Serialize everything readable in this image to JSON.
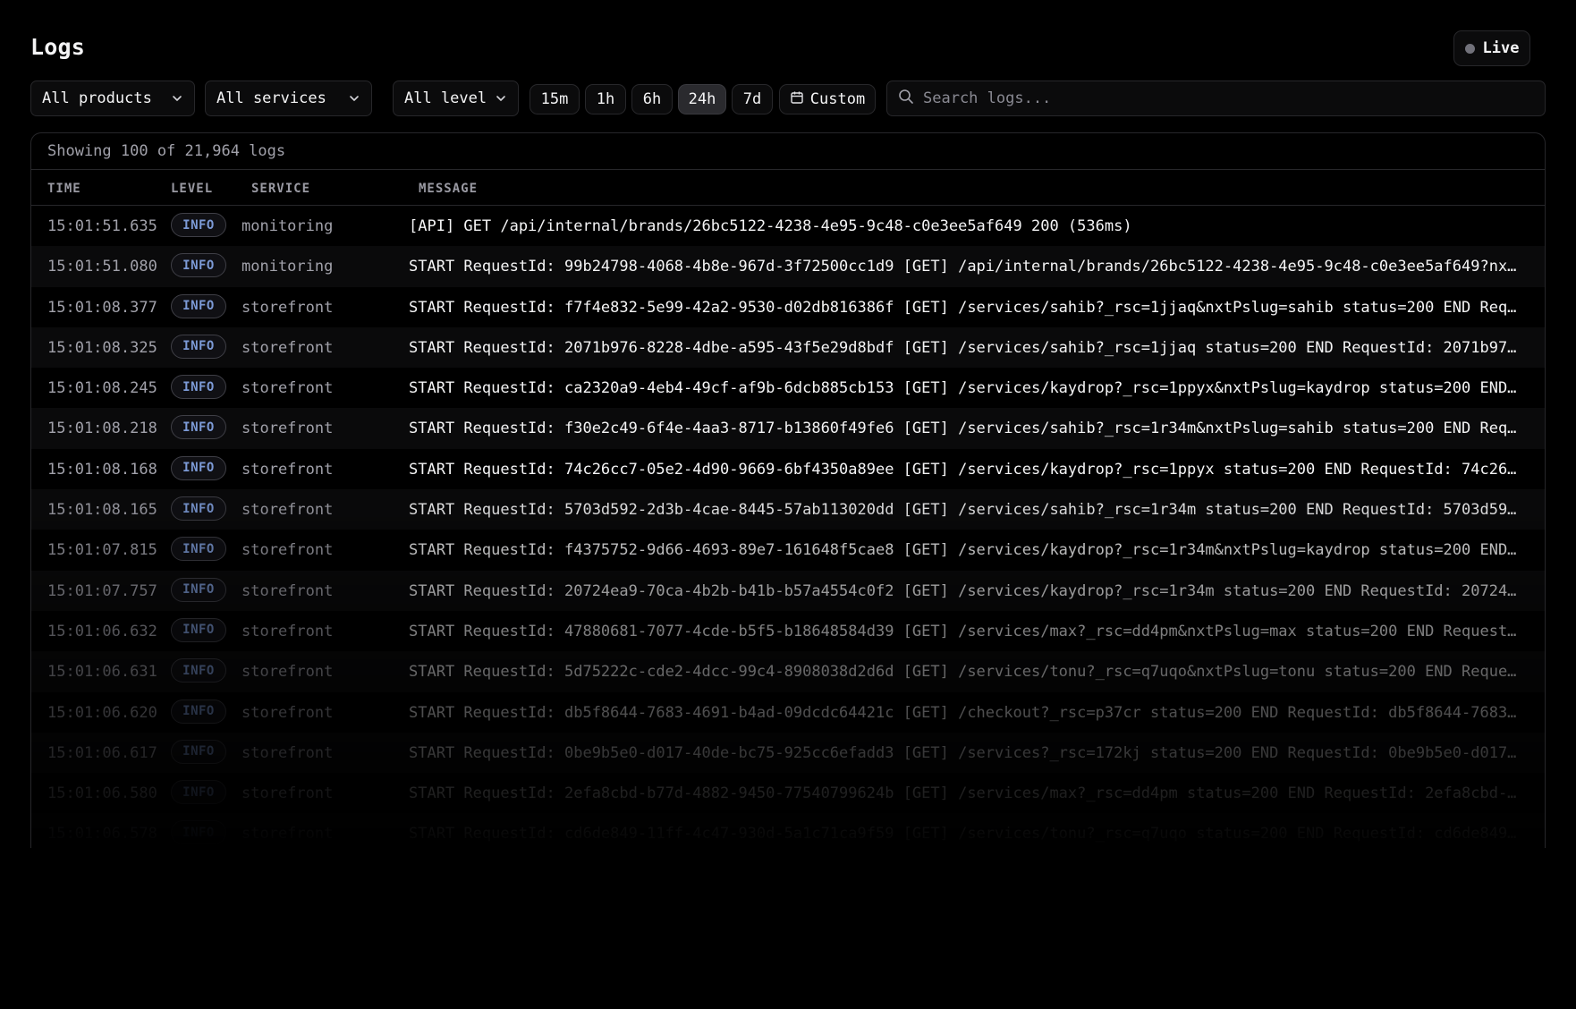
{
  "header": {
    "title": "Logs",
    "live_label": "Live"
  },
  "filters": {
    "products": "All products",
    "services": "All services",
    "level": "All level",
    "time_ranges": [
      "15m",
      "1h",
      "6h",
      "24h",
      "7d"
    ],
    "active_range": "24h",
    "custom_label": "Custom",
    "search_placeholder": "Search logs..."
  },
  "summary": "Showing 100 of 21,964 logs",
  "columns": {
    "time": "TIME",
    "level": "LEVEL",
    "service": "SERVICE",
    "message": "MESSAGE"
  },
  "colors": {
    "level_info": "#7c9ad6",
    "background": "#000000",
    "border": "#27272a"
  },
  "rows": [
    {
      "time": "15:01:51.635",
      "level": "INFO",
      "service": "monitoring",
      "message": "[API] GET /api/internal/brands/26bc5122-4238-4e95-9c48-c0e3ee5af649 200 (536ms)"
    },
    {
      "time": "15:01:51.080",
      "level": "INFO",
      "service": "monitoring",
      "message": "START RequestId: 99b24798-4068-4b8e-967d-3f72500cc1d9 [GET] /api/internal/brands/26bc5122-4238-4e95-9c48-c0e3ee5af649?nx…"
    },
    {
      "time": "15:01:08.377",
      "level": "INFO",
      "service": "storefront",
      "message": "START RequestId: f7f4e832-5e99-42a2-9530-d02db816386f [GET] /services/sahib?_rsc=1jjaq&nxtPslug=sahib status=200 END Req…"
    },
    {
      "time": "15:01:08.325",
      "level": "INFO",
      "service": "storefront",
      "message": "START RequestId: 2071b976-8228-4dbe-a595-43f5e29d8bdf [GET] /services/sahib?_rsc=1jjaq status=200 END RequestId: 2071b97…"
    },
    {
      "time": "15:01:08.245",
      "level": "INFO",
      "service": "storefront",
      "message": "START RequestId: ca2320a9-4eb4-49cf-af9b-6dcb885cb153 [GET] /services/kaydrop?_rsc=1ppyx&nxtPslug=kaydrop status=200 END…"
    },
    {
      "time": "15:01:08.218",
      "level": "INFO",
      "service": "storefront",
      "message": "START RequestId: f30e2c49-6f4e-4aa3-8717-b13860f49fe6 [GET] /services/sahib?_rsc=1r34m&nxtPslug=sahib status=200 END Req…"
    },
    {
      "time": "15:01:08.168",
      "level": "INFO",
      "service": "storefront",
      "message": "START RequestId: 74c26cc7-05e2-4d90-9669-6bf4350a89ee [GET] /services/kaydrop?_rsc=1ppyx status=200 END RequestId: 74c26…"
    },
    {
      "time": "15:01:08.165",
      "level": "INFO",
      "service": "storefront",
      "message": "START RequestId: 5703d592-2d3b-4cae-8445-57ab113020dd [GET] /services/sahib?_rsc=1r34m status=200 END RequestId: 5703d59…"
    },
    {
      "time": "15:01:07.815",
      "level": "INFO",
      "service": "storefront",
      "message": "START RequestId: f4375752-9d66-4693-89e7-161648f5cae8 [GET] /services/kaydrop?_rsc=1r34m&nxtPslug=kaydrop status=200 END…"
    },
    {
      "time": "15:01:07.757",
      "level": "INFO",
      "service": "storefront",
      "message": "START RequestId: 20724ea9-70ca-4b2b-b41b-b57a4554c0f2 [GET] /services/kaydrop?_rsc=1r34m status=200 END RequestId: 20724…"
    },
    {
      "time": "15:01:06.632",
      "level": "INFO",
      "service": "storefront",
      "message": "START RequestId: 47880681-7077-4cde-b5f5-b18648584d39 [GET] /services/max?_rsc=dd4pm&nxtPslug=max status=200 END Request…"
    },
    {
      "time": "15:01:06.631",
      "level": "INFO",
      "service": "storefront",
      "message": "START RequestId: 5d75222c-cde2-4dcc-99c4-8908038d2d6d [GET] /services/tonu?_rsc=q7uqo&nxtPslug=tonu status=200 END Reque…"
    },
    {
      "time": "15:01:06.620",
      "level": "INFO",
      "service": "storefront",
      "message": "START RequestId: db5f8644-7683-4691-b4ad-09dcdc64421c [GET] /checkout?_rsc=p37cr status=200 END RequestId: db5f8644-7683…"
    },
    {
      "time": "15:01:06.617",
      "level": "INFO",
      "service": "storefront",
      "message": "START RequestId: 0be9b5e0-d017-40de-bc75-925cc6efadd3 [GET] /services?_rsc=172kj status=200 END RequestId: 0be9b5e0-d017…"
    },
    {
      "time": "15:01:06.580",
      "level": "INFO",
      "service": "storefront",
      "message": "START RequestId: 2efa8cbd-b77d-4882-9450-77540799624b [GET] /services/max?_rsc=dd4pm status=200 END RequestId: 2efa8cbd-…"
    },
    {
      "time": "15:01:06.578",
      "level": "INFO",
      "service": "storefront",
      "message": "START RequestId: cd6de849-11ff-4c47-930d-5a1c71ca9f59 [GET] /services/tonu?_rsc=q7uqo status=200 END RequestId: cd6de849…"
    }
  ]
}
